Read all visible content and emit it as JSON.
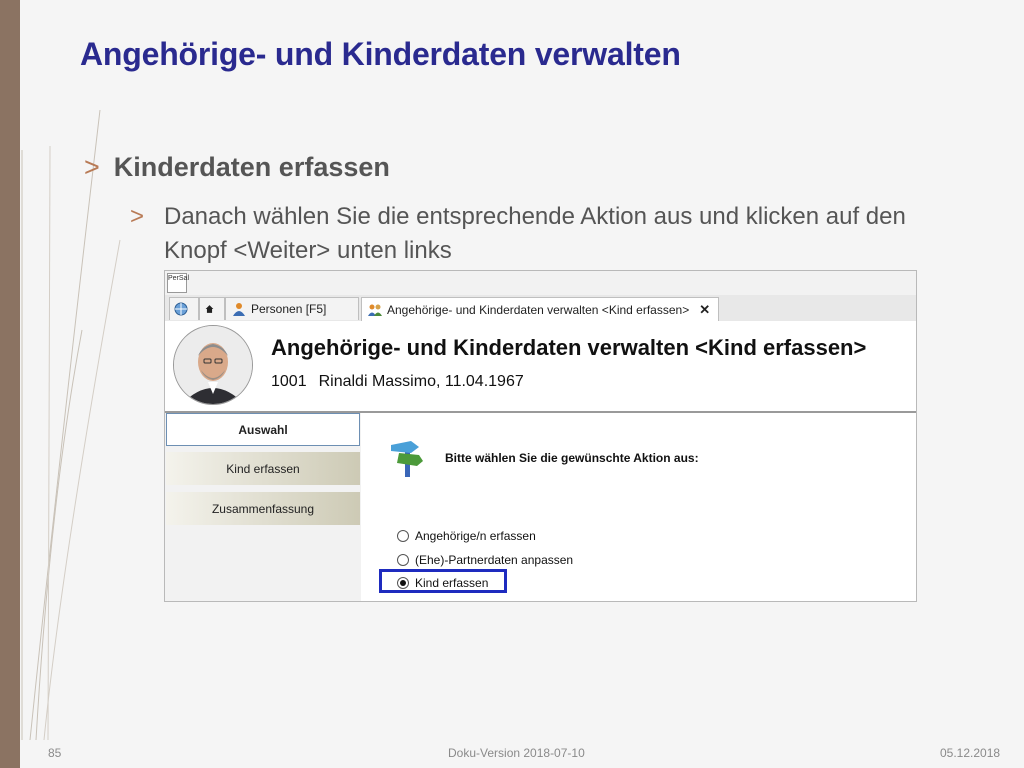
{
  "slide": {
    "title": "Angehörige- und Kinderdaten verwalten",
    "bullet1": "Kinderdaten erfassen",
    "bullet2": "Danach wählen Sie die entsprechende Aktion aus und klicken auf den Knopf <Weiter> unten links",
    "chevron": ">"
  },
  "app": {
    "icon_text": "PerSal",
    "tabs": [
      {
        "label": "Personen [F5]"
      },
      {
        "label": "Angehörige- und Kinderdaten verwalten <Kind erfassen>",
        "close": "✕"
      }
    ],
    "header": {
      "title": "Angehörige- und Kinderdaten verwalten <Kind erfassen>",
      "employee_no": "1001",
      "employee": "Rinaldi Massimo, 11.04.1967"
    },
    "nav": [
      {
        "label": "Auswahl",
        "active": true
      },
      {
        "label": "Kind erfassen",
        "active": false
      },
      {
        "label": "Zusammenfassung",
        "active": false
      }
    ],
    "prompt": "Bitte wählen Sie die gewünschte Aktion aus:",
    "options": [
      {
        "label": "Angehörige/n erfassen",
        "selected": false
      },
      {
        "label": "(Ehe)-Partnerdaten anpassen",
        "selected": false
      },
      {
        "label": "Kind erfassen",
        "selected": true
      }
    ]
  },
  "footer": {
    "page": "85",
    "version": "Doku-Version 2018-07-10",
    "date": "05.12.2018"
  },
  "colors": {
    "title": "#2a2a8f",
    "accent_chevron": "#b87a55",
    "sidebar_strip": "#8b7362",
    "highlight": "#1e2bbf"
  }
}
